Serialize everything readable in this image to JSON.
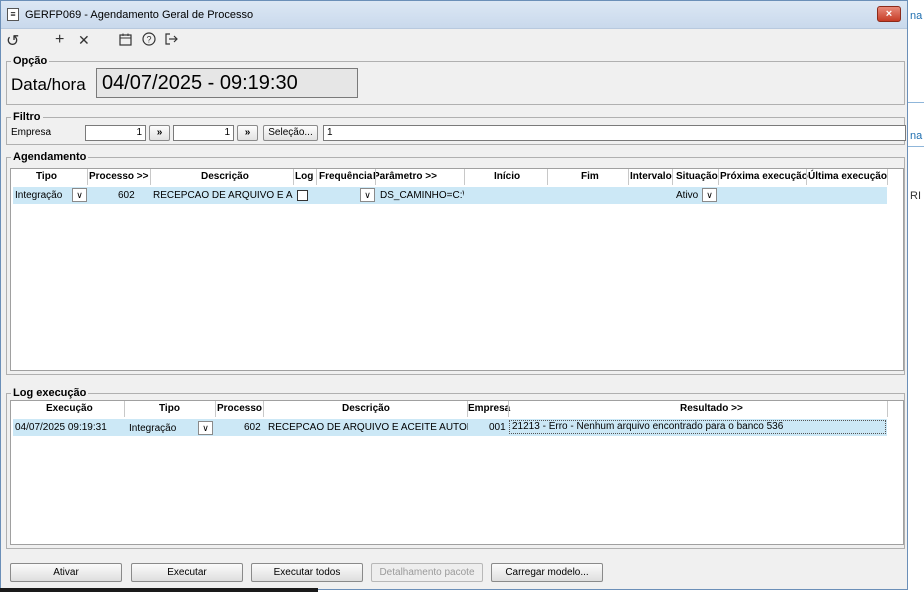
{
  "window": {
    "title": "GERFP069 - Agendamento Geral de Processo",
    "close_label": "×"
  },
  "toolbar": {
    "undo": "↺",
    "add": "+",
    "remove": "✕",
    "calendar": "📅",
    "help": "?",
    "exit": "⇥"
  },
  "opcao": {
    "legend": "Opção",
    "label": "Data/hora",
    "value": "04/07/2025  -  09:19:30"
  },
  "filtro": {
    "legend": "Filtro",
    "empresa_label": "Empresa",
    "from_value": "1",
    "to_value": "1",
    "next_label": "»",
    "selecao_label": "Seleção...",
    "selecao_value": "1"
  },
  "agendamento": {
    "legend": "Agendamento",
    "columns": [
      "Tipo",
      "Processo >>",
      "Descrição",
      "Log",
      "Frequência",
      "Parâmetro >>",
      "Início",
      "Fim",
      "Intervalo",
      "Situação",
      "Próxima execução",
      "Última execução"
    ],
    "row": {
      "tipo": "Integração",
      "processo": "602",
      "descricao": "RECEPCAO DE ARQUIVO E ACEI",
      "log_checked": false,
      "frequencia": "",
      "parametro": "DS_CAMINHO=C:\\A",
      "inicio": "",
      "fim": "",
      "intervalo": "",
      "situacao": "Ativo",
      "proxima": "",
      "ultima": ""
    }
  },
  "log": {
    "legend": "Log execução",
    "columns": [
      "Execução",
      "Tipo",
      "Processo",
      "Descrição",
      "Empresa",
      "Resultado >>"
    ],
    "row": {
      "execucao": "04/07/2025 09:19:31",
      "tipo": "Integração",
      "processo": "602",
      "descricao": "RECEPCAO DE ARQUIVO E ACEITE AUTOMAT",
      "empresa": "001",
      "resultado": "21213 -  Erro - Nenhum arquivo encontrado para o banco 536"
    }
  },
  "buttons": {
    "ativar": "Ativar",
    "executar": "Executar",
    "executar_todos": "Executar todos",
    "detalhamento": "Detalhamento pacote",
    "carregar": "Carregar modelo..."
  },
  "background": {
    "t1": "na",
    "t2": "na",
    "t3": "RI"
  }
}
